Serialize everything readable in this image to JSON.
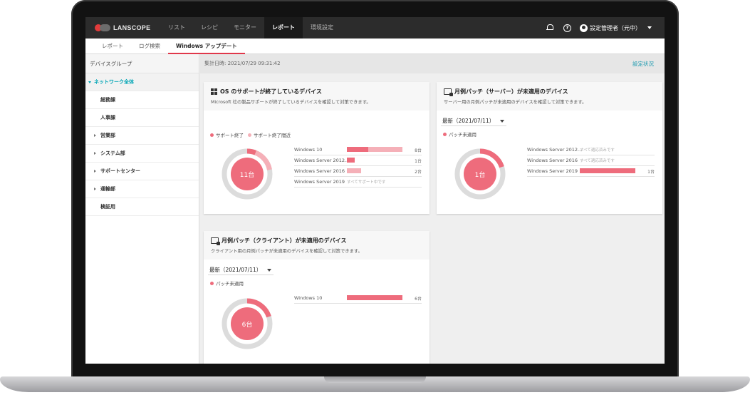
{
  "colors": {
    "accent": "#e0384b",
    "primary_bar": "#ee6c7c",
    "secondary_bar": "#f5b0b8",
    "donut_track": "#dcdcdc",
    "link": "#1e9bb0"
  },
  "topnav": {
    "logo": "LANSCOPE",
    "items": [
      {
        "label": "リスト",
        "active": false
      },
      {
        "label": "レシピ",
        "active": false
      },
      {
        "label": "モニター",
        "active": false
      },
      {
        "label": "レポート",
        "active": true
      },
      {
        "label": "環境設定",
        "active": false
      }
    ],
    "help": "?",
    "user": "設定管理者（元中）"
  },
  "subnav": {
    "items": [
      {
        "label": "レポート",
        "active": false
      },
      {
        "label": "ログ検索",
        "active": false
      },
      {
        "label": "Windows アップデート",
        "active": true
      }
    ]
  },
  "sidebar": {
    "header": "デバイスグループ",
    "root": "ネットワーク全体",
    "items": [
      {
        "label": "総務課",
        "expandable": false
      },
      {
        "label": "人事課",
        "expandable": false
      },
      {
        "label": "営業部",
        "expandable": true
      },
      {
        "label": "システム部",
        "expandable": true
      },
      {
        "label": "サポートセンター",
        "expandable": true
      },
      {
        "label": "運輸部",
        "expandable": true
      },
      {
        "label": "検証用",
        "expandable": false
      }
    ]
  },
  "content": {
    "timestamp": "集計日時: 2021/07/29 09:31:42",
    "settings_link": "設定状況"
  },
  "cards": {
    "os": {
      "title": "OS のサポートが終了しているデバイス",
      "subtitle": "Microsoft 社の製品サポートが終了しているデバイスを確認して対策できます。",
      "legend": [
        "サポート終了",
        "サポート終了間近"
      ],
      "total": "11台",
      "donut": {
        "primary": 0.06,
        "secondary": 0.16
      },
      "rows": [
        {
          "name": "Windows 10",
          "value": "8台",
          "primary": 0.38,
          "secondary": 0.62
        },
        {
          "name": "Windows Server 2012...",
          "value": "1台",
          "primary": 0.14,
          "secondary": 0
        },
        {
          "name": "Windows Server 2016",
          "value": "2台",
          "primary": 0,
          "secondary": 0.26
        },
        {
          "name": "Windows Server 2019",
          "value": "",
          "note": "すべてサポート中です",
          "primary": 0,
          "secondary": 0
        }
      ]
    },
    "server": {
      "title": "月例パッチ（サーバー）が未適用のデバイス",
      "subtitle": "サーバー用の月例パッチが未適用のデバイスを確認して対策できます。",
      "select": "最新（2021/07/11）",
      "legend": [
        "パッチ未適用"
      ],
      "total": "1台",
      "donut": {
        "primary": 0.2
      },
      "rows": [
        {
          "name": "Windows Server 2012...",
          "value": "",
          "note": "すべて適応済みです",
          "primary": 0
        },
        {
          "name": "Windows Server 2016",
          "value": "",
          "note": "すべて適応済みです",
          "primary": 0
        },
        {
          "name": "Windows Server 2019",
          "value": "1台",
          "primary": 1
        }
      ]
    },
    "client": {
      "title": "月例パッチ（クライアント）が未適用のデバイス",
      "subtitle": "クライアント用の月例パッチが未適用のデバイスを確認して対策できます。",
      "select": "最新（2021/07/11）",
      "legend": [
        "パッチ未適用"
      ],
      "total": "6台",
      "donut": {
        "primary": 0.2
      },
      "rows": [
        {
          "name": "Windows 10",
          "value": "6台",
          "primary": 1
        }
      ]
    }
  }
}
